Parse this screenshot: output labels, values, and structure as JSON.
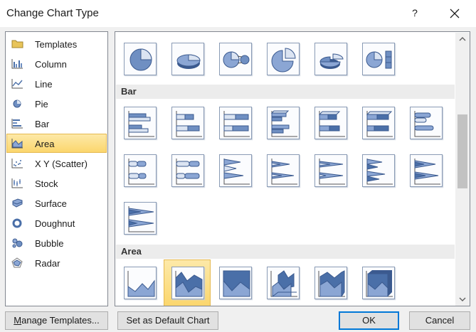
{
  "window": {
    "title": "Change Chart Type",
    "help_label": "?"
  },
  "categories": [
    {
      "label": "Templates",
      "icon": "folder-icon",
      "selected": false
    },
    {
      "label": "Column",
      "icon": "column-chart-icon",
      "selected": false
    },
    {
      "label": "Line",
      "icon": "line-chart-icon",
      "selected": false
    },
    {
      "label": "Pie",
      "icon": "pie-chart-icon",
      "selected": false
    },
    {
      "label": "Bar",
      "icon": "bar-chart-icon",
      "selected": false
    },
    {
      "label": "Area",
      "icon": "area-chart-icon",
      "selected": true
    },
    {
      "label": "X Y (Scatter)",
      "icon": "scatter-chart-icon",
      "selected": false
    },
    {
      "label": "Stock",
      "icon": "stock-chart-icon",
      "selected": false
    },
    {
      "label": "Surface",
      "icon": "surface-chart-icon",
      "selected": false
    },
    {
      "label": "Doughnut",
      "icon": "doughnut-chart-icon",
      "selected": false
    },
    {
      "label": "Bubble",
      "icon": "bubble-chart-icon",
      "selected": false
    },
    {
      "label": "Radar",
      "icon": "radar-chart-icon",
      "selected": false
    }
  ],
  "gallery": {
    "pie_thumbs": [
      "pie-icon",
      "pie-3d-icon",
      "pie-of-pie-icon",
      "exploded-pie-icon",
      "exploded-pie-3d-icon",
      "bar-of-pie-icon"
    ],
    "bar_section": {
      "label": "Bar",
      "thumbs": [
        "clustered-bar-icon",
        "stacked-bar-icon",
        "100-stacked-bar-icon",
        "clustered-bar-3d-icon",
        "stacked-bar-3d-icon",
        "100-stacked-bar-3d-icon",
        "clustered-horizontal-cylinder-icon",
        "stacked-horizontal-cylinder-icon",
        "100-stacked-horizontal-cylinder-icon",
        "clustered-horizontal-cone-icon",
        "stacked-horizontal-cone-icon",
        "100-stacked-horizontal-cone-icon",
        "clustered-horizontal-pyramid-icon",
        "stacked-horizontal-pyramid-icon",
        "100-stacked-horizontal-pyramid-icon"
      ]
    },
    "area_section": {
      "label": "Area",
      "thumbs": [
        "area-icon",
        "stacked-area-icon",
        "100-stacked-area-icon",
        "area-3d-icon",
        "stacked-area-3d-icon",
        "100-stacked-area-3d-icon"
      ],
      "selected_index": 1
    }
  },
  "buttons": {
    "manage_templates_prefix": "M",
    "manage_templates_rest": "anage Templates...",
    "set_default": "Set as Default Chart",
    "ok": "OK",
    "cancel": "Cancel"
  },
  "colors": {
    "selection_fill": "#fbd66d",
    "selection_border": "#e5b950",
    "chart_blue": "#4a6fa8",
    "default_button_border": "#0078d7"
  }
}
